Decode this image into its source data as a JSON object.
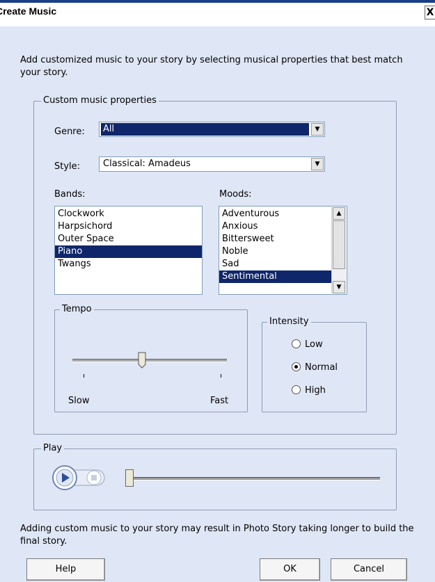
{
  "window": {
    "title": "Create Music",
    "close_label": "X"
  },
  "intro_text": "Add customized music to your story by selecting musical properties that best match your story.",
  "custom_group": {
    "legend": "Custom music properties",
    "genre_label": "Genre:",
    "genre_value": "All",
    "style_label": "Style:",
    "style_value": "Classical: Amadeus",
    "bands_label": "Bands:",
    "bands": [
      "Clockwork",
      "Harpsichord",
      "Outer Space",
      "Piano",
      "Twangs"
    ],
    "bands_selected": "Piano",
    "moods_label": "Moods:",
    "moods": [
      "Adventurous",
      "Anxious",
      "Bittersweet",
      "Noble",
      "Sad",
      "Sentimental"
    ],
    "moods_selected": "Sentimental",
    "tempo": {
      "legend": "Tempo",
      "slow_label": "Slow",
      "fast_label": "Fast",
      "value": 0.45
    },
    "intensity": {
      "legend": "Intensity",
      "options": [
        "Low",
        "Normal",
        "High"
      ],
      "selected": "Normal"
    }
  },
  "play_group": {
    "legend": "Play",
    "position": 0.0
  },
  "footer_text": "Adding custom music to your story may result in Photo Story taking longer to build the final story.",
  "buttons": {
    "help": "Help",
    "ok": "OK",
    "cancel": "Cancel"
  },
  "colors": {
    "selection": "#10266a",
    "background": "#dfe6f5",
    "titlebar_accent": "#1a3f8a"
  }
}
